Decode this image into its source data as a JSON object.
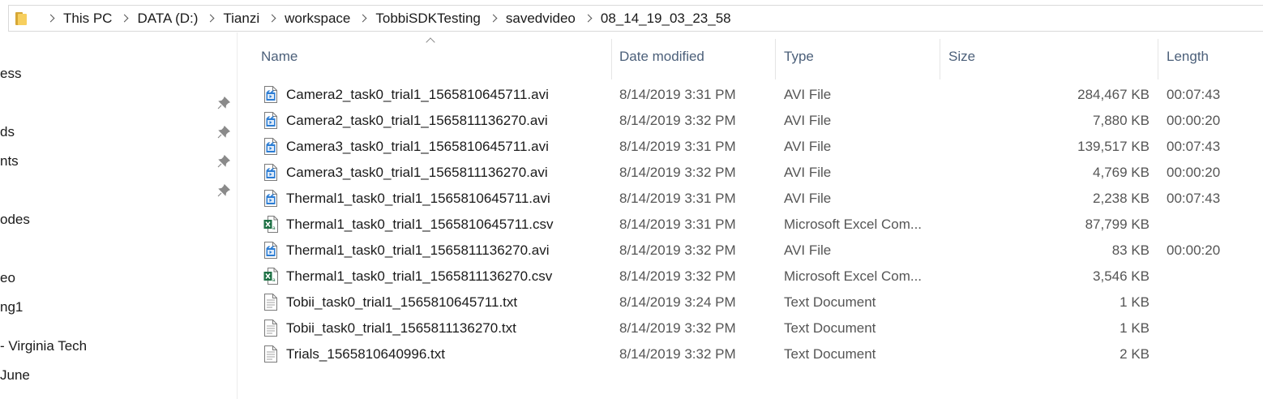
{
  "address": {
    "crumbs": [
      "This PC",
      "DATA (D:)",
      "Tianzi",
      "workspace",
      "TobbiSDKTesting",
      "savedvideo",
      "08_14_19_03_23_58"
    ]
  },
  "nav": {
    "items": [
      "ess",
      "ds",
      "nts",
      "odes",
      "eo",
      "ng1",
      "- Virginia Tech",
      " June"
    ]
  },
  "columns": {
    "name": "Name",
    "date": "Date modified",
    "type": "Type",
    "size": "Size",
    "length": "Length"
  },
  "files": [
    {
      "name": "Camera2_task0_trial1_1565810645711.avi",
      "date": "8/14/2019 3:31 PM",
      "type": "AVI File",
      "size": "284,467 KB",
      "length": "00:07:43",
      "icon": "video-file-icon"
    },
    {
      "name": "Camera2_task0_trial1_1565811136270.avi",
      "date": "8/14/2019 3:32 PM",
      "type": "AVI File",
      "size": "7,880 KB",
      "length": "00:00:20",
      "icon": "video-file-icon"
    },
    {
      "name": "Camera3_task0_trial1_1565810645711.avi",
      "date": "8/14/2019 3:31 PM",
      "type": "AVI File",
      "size": "139,517 KB",
      "length": "00:07:43",
      "icon": "video-file-icon"
    },
    {
      "name": "Camera3_task0_trial1_1565811136270.avi",
      "date": "8/14/2019 3:32 PM",
      "type": "AVI File",
      "size": "4,769 KB",
      "length": "00:00:20",
      "icon": "video-file-icon"
    },
    {
      "name": "Thermal1_task0_trial1_1565810645711.avi",
      "date": "8/14/2019 3:31 PM",
      "type": "AVI File",
      "size": "2,238 KB",
      "length": "00:07:43",
      "icon": "video-file-icon"
    },
    {
      "name": "Thermal1_task0_trial1_1565810645711.csv",
      "date": "8/14/2019 3:31 PM",
      "type": "Microsoft Excel Com...",
      "size": "87,799 KB",
      "length": "",
      "icon": "excel-file-icon"
    },
    {
      "name": "Thermal1_task0_trial1_1565811136270.avi",
      "date": "8/14/2019 3:32 PM",
      "type": "AVI File",
      "size": "83 KB",
      "length": "00:00:20",
      "icon": "video-file-icon"
    },
    {
      "name": "Thermal1_task0_trial1_1565811136270.csv",
      "date": "8/14/2019 3:32 PM",
      "type": "Microsoft Excel Com...",
      "size": "3,546 KB",
      "length": "",
      "icon": "excel-file-icon"
    },
    {
      "name": "Tobii_task0_trial1_1565810645711.txt",
      "date": "8/14/2019 3:24 PM",
      "type": "Text Document",
      "size": "1 KB",
      "length": "",
      "icon": "text-file-icon"
    },
    {
      "name": "Tobii_task0_trial1_1565811136270.txt",
      "date": "8/14/2019 3:32 PM",
      "type": "Text Document",
      "size": "1 KB",
      "length": "",
      "icon": "text-file-icon"
    },
    {
      "name": "Trials_1565810640996.txt",
      "date": "8/14/2019 3:32 PM",
      "type": "Text Document",
      "size": "2 KB",
      "length": "",
      "icon": "text-file-icon"
    }
  ],
  "colors": {
    "header_text": "#4c607a",
    "video_icon": "#2b7cd3",
    "excel_icon": "#1e7145"
  }
}
